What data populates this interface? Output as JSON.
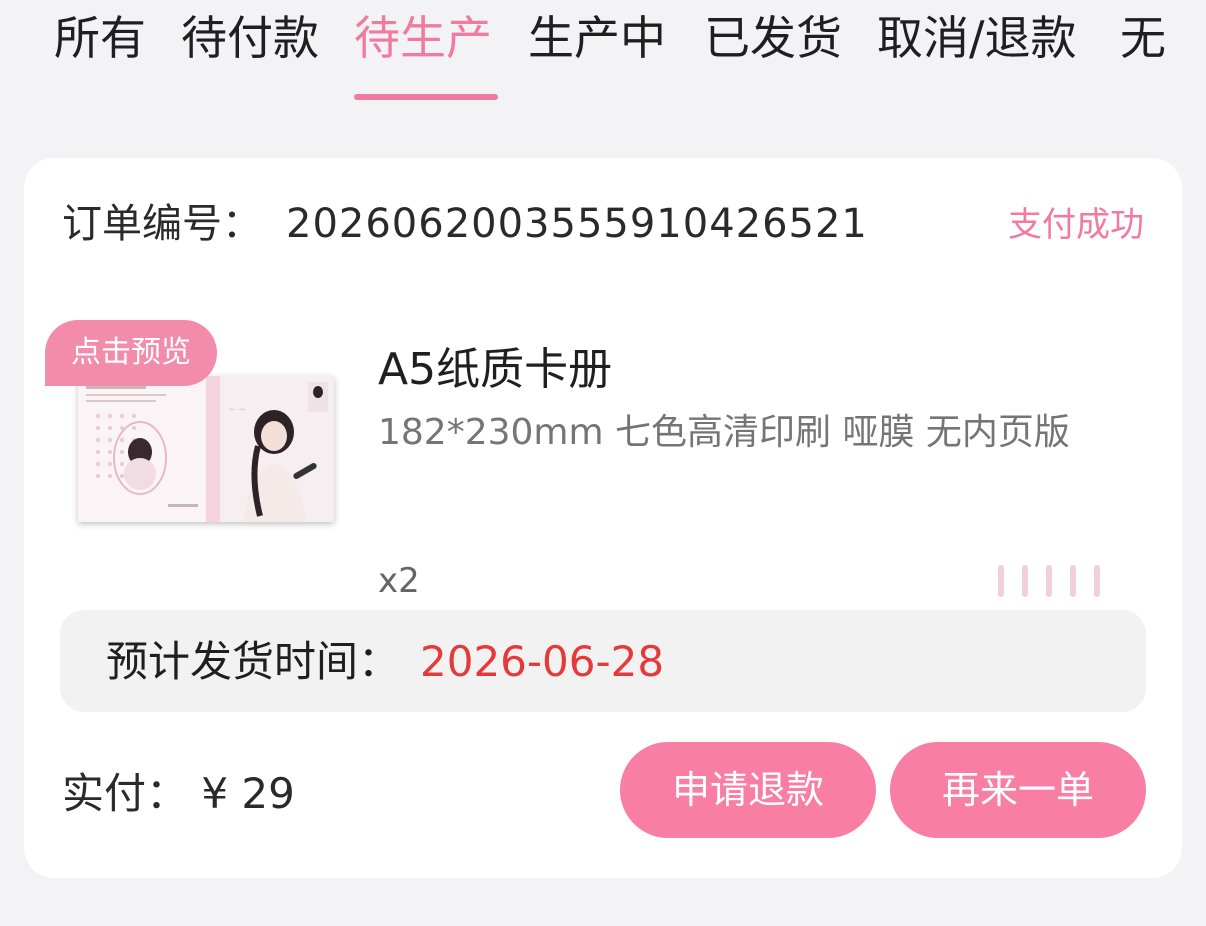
{
  "tabs": [
    {
      "label": "所有"
    },
    {
      "label": "待付款"
    },
    {
      "label": "待生产"
    },
    {
      "label": "生产中"
    },
    {
      "label": "已发货"
    },
    {
      "label": "取消/退款"
    },
    {
      "label": "无"
    }
  ],
  "active_tab": "待生产",
  "order": {
    "number_label": "订单编号：",
    "number": "20260620035559104265 21",
    "status": "支付成功",
    "preview_badge": "点击预览",
    "product_title": "A5纸质卡册",
    "product_spec": "182*230mm 七色高清印刷 哑膜 无内页版",
    "quantity": "x2",
    "ship_label": "预计发货时间：",
    "ship_date": "2026-06-28",
    "paid_label": "实付：",
    "paid_amount": "¥ 29",
    "refund_button": "申请退款",
    "reorder_button": "再来一单"
  },
  "colors": {
    "accent": "#f07aa0",
    "button": "#f87ea4",
    "date": "#e53a3a",
    "background": "#f3f3f5"
  }
}
